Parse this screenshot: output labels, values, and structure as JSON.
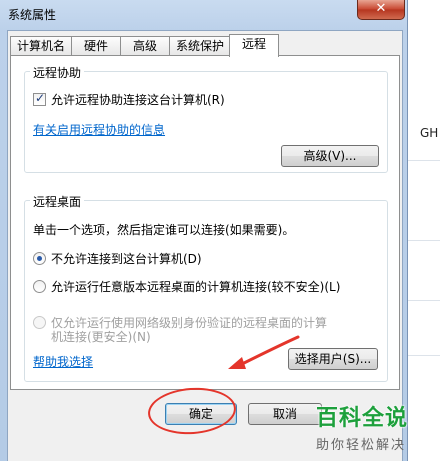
{
  "window": {
    "title": "系统属性",
    "close_glyph": "✕"
  },
  "background": {
    "text": "GH"
  },
  "tabs": [
    {
      "label": "计算机名"
    },
    {
      "label": "硬件"
    },
    {
      "label": "高级"
    },
    {
      "label": "系统保护"
    },
    {
      "label": "远程"
    }
  ],
  "remote_assistance": {
    "group_title": "远程协助",
    "allow_checkbox_label": "允许远程协助连接这台计算机(R)",
    "allow_checked": true,
    "info_link": "有关启用远程协助的信息",
    "advanced_button": "高级(V)..."
  },
  "remote_desktop": {
    "group_title": "远程桌面",
    "instruction": "单击一个选项，然后指定谁可以连接(如果需要)。",
    "option_none": "不允许连接到这台计算机(D)",
    "option_any_line1": "允许运行任意版本远程桌面的计算机连接(较不安全)(L)",
    "option_nla_line1": "仅允许运行使用网络级别身份验证的远程桌面的计算",
    "option_nla_line2": "机连接(更安全)(N)",
    "selected": "option_none",
    "help_link": "帮助我选择",
    "select_users_button": "选择用户(S)..."
  },
  "footer": {
    "ok_button": "确定",
    "cancel_button": "取消"
  },
  "watermark": {
    "main": "百科全说",
    "sub": "助你轻松解决"
  },
  "colors": {
    "link": "#0066cc",
    "annotation_red": "#e4352b",
    "watermark_green": "#1da03c"
  }
}
